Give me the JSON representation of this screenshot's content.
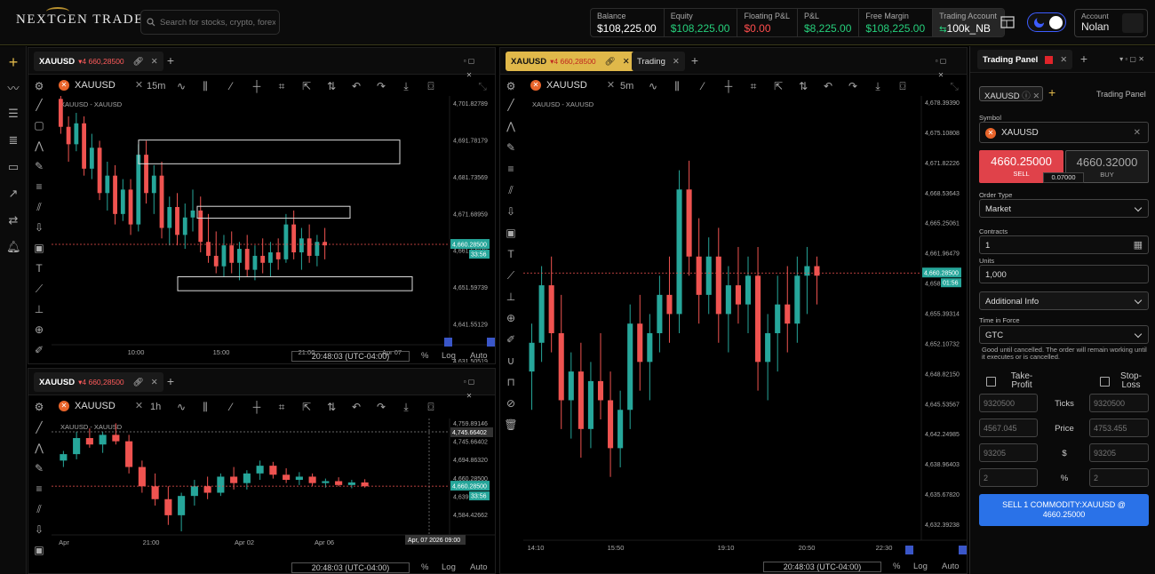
{
  "app": {
    "logo_text": "NEXTGEN TRADER"
  },
  "search": {
    "placeholder": "Search for stocks, crypto, forex..."
  },
  "stats": [
    {
      "label": "Balance",
      "value": "$108,225.00",
      "color": "#ffffff"
    },
    {
      "label": "Equity",
      "value": "$108,225.00",
      "color": "#26d07c"
    },
    {
      "label": "Floating P&L",
      "value": "$0.00",
      "color": "#ff4d4d"
    },
    {
      "label": "P&L",
      "value": "$8,225.00",
      "color": "#26d07c"
    },
    {
      "label": "Free Margin",
      "value": "$108,225.00",
      "color": "#26d07c"
    },
    {
      "label": "Trading Account",
      "value": "100k_NB",
      "color": "#ffffff"
    }
  ],
  "account": {
    "label": "Account",
    "name": "Nolan"
  },
  "colors": {
    "up": "#26a69a",
    "down": "#ef5350",
    "accent": "#e0b84a",
    "sell": "#e0424a",
    "buy_btn": "#1a1a1a",
    "order": "#2a72e8"
  },
  "panels": {
    "p1": {
      "tab_symbol": "XAUUSD",
      "tab_price": "▾4 660,28500",
      "symbol": "XAUUSD",
      "tf": "15m",
      "chart_title": "XAUUSD - XAUUSD",
      "yticks": [
        "4,701.82789",
        "4,691.78179",
        "4,681.73569",
        "4,671.68959",
        "4,661.64349",
        "4,651.59739",
        "4,641.55129",
        "4,631.50519"
      ],
      "xticks": [
        "10:00",
        "15:00",
        "21:00",
        "Apr 07"
      ],
      "price_label": "4,660.28500",
      "countdown": "33:56",
      "time": "20:48:03 (UTC-04:00)",
      "pct": "%",
      "log": "Log",
      "auto": "Auto"
    },
    "p2": {
      "tab_symbol": "XAUUSD",
      "tab_price": "▾4 660,28500",
      "tab2": "Trading",
      "symbol": "XAUUSD",
      "tf": "5m",
      "chart_title": "XAUUSD - XAUUSD",
      "yticks": [
        "4,678.39390",
        "4,675.10808",
        "4,671.82226",
        "4,668.53643",
        "4,665.25061",
        "4,661.96479",
        "4,658.67897",
        "4,655.39314",
        "4,652.10732",
        "4,648.82150",
        "4,645.53567",
        "4,642.24985",
        "4,638.96403",
        "4,635.67820",
        "4,632.39238"
      ],
      "xticks": [
        "14:10",
        "15:50",
        "19:10",
        "20:50",
        "22:30"
      ],
      "price_label": "4,660.28500",
      "countdown": "01:56",
      "time": "20:48:03 (UTC-04:00)",
      "pct": "%",
      "log": "Log",
      "auto": "Auto"
    },
    "p3": {
      "tab_symbol": "XAUUSD",
      "tab_price": "▾4 660,28500",
      "symbol": "XAUUSD",
      "tf": "1h",
      "chart_title": "XAUUSD - XAUUSD",
      "yticks": [
        "4,759.89146",
        "4,745.66402",
        "4,694.86320",
        "4,660.28500",
        "4,639.14...",
        "4,584.42662"
      ],
      "xticks": [
        "Apr",
        "21:00",
        "Apr 02",
        "Apr 06"
      ],
      "crosshair_price": "4,745.66402",
      "crosshair_time": "Apr, 07 2026 09:00",
      "price_label": "4,660.28500",
      "countdown": "33:56",
      "time": "20:48:03 (UTC-04:00)",
      "pct": "%",
      "log": "Log",
      "auto": "Auto"
    }
  },
  "trading_panel": {
    "tab": "Trading Panel",
    "header": "Trading Panel",
    "chip": "XAUUSD",
    "symbol_label": "Symbol",
    "symbol": "XAUUSD",
    "sell_price": "4660.25000",
    "sell_label": "SELL",
    "buy_price": "4660.32000",
    "buy_label": "BUY",
    "spread": "0.07000",
    "order_type_label": "Order Type",
    "order_type": "Market",
    "contracts_label": "Contracts",
    "contracts": "1",
    "units_label": "Units",
    "units": "1,000",
    "additional_info": "Additional Info",
    "tif_label": "Time in Force",
    "tif": "GTC",
    "tif_note": "Good until cancelled. The order will remain working until it executes or is cancelled.",
    "tp_label": "Take-Profit",
    "sl_label": "Stop-Loss",
    "rows": [
      {
        "label": "Ticks",
        "tp": "9320500",
        "sl": "9320500"
      },
      {
        "label": "Price",
        "tp": "4567.045",
        "sl": "4753.455"
      },
      {
        "label": "$",
        "tp": "93205",
        "sl": "93205"
      },
      {
        "label": "%",
        "tp": "2",
        "sl": "2"
      }
    ],
    "submit": "SELL 1 COMMODITY:XAUUSD @ 4660.25000"
  },
  "chart_data": [
    {
      "type": "candlestick",
      "title": "XAUUSD - XAUUSD",
      "timeframe": "15m",
      "x_ticks": [
        "10:00",
        "15:00",
        "21:00",
        "Apr 07"
      ],
      "ylim": [
        4631.5,
        4701.83
      ],
      "last_price": 4660.285,
      "candles": [
        [
          4702,
          4706,
          4692,
          4694
        ],
        [
          4694,
          4697,
          4684,
          4689
        ],
        [
          4689,
          4698,
          4687,
          4695
        ],
        [
          4695,
          4697,
          4680,
          4682
        ],
        [
          4682,
          4692,
          4679,
          4688
        ],
        [
          4688,
          4690,
          4673,
          4675
        ],
        [
          4675,
          4684,
          4670,
          4680
        ],
        [
          4680,
          4683,
          4666,
          4669
        ],
        [
          4669,
          4679,
          4667,
          4676
        ],
        [
          4676,
          4679,
          4663,
          4666
        ],
        [
          4666,
          4689,
          4664,
          4686
        ],
        [
          4686,
          4690,
          4672,
          4675
        ],
        [
          4675,
          4683,
          4669,
          4680
        ],
        [
          4680,
          4684,
          4662,
          4665
        ],
        [
          4665,
          4674,
          4660,
          4671
        ],
        [
          4671,
          4675,
          4660,
          4663
        ],
        [
          4663,
          4672,
          4659,
          4668
        ],
        [
          4668,
          4676,
          4664,
          4670
        ],
        [
          4670,
          4674,
          4658,
          4661
        ],
        [
          4661,
          4669,
          4655,
          4657
        ],
        [
          4657,
          4664,
          4652,
          4654
        ],
        [
          4654,
          4663,
          4651,
          4660
        ],
        [
          4660,
          4664,
          4652,
          4655
        ],
        [
          4655,
          4661,
          4650,
          4659
        ],
        [
          4659,
          4663,
          4651,
          4653
        ],
        [
          4653,
          4660,
          4650,
          4657
        ],
        [
          4657,
          4662,
          4652,
          4655
        ],
        [
          4655,
          4661,
          4651,
          4658
        ],
        [
          4658,
          4662,
          4653,
          4656
        ],
        [
          4656,
          4669,
          4655,
          4666
        ],
        [
          4666,
          4670,
          4656,
          4658
        ],
        [
          4658,
          4665,
          4653,
          4662
        ],
        [
          4662,
          4666,
          4655,
          4657
        ],
        [
          4657,
          4663,
          4654,
          4661
        ],
        [
          4661,
          4665,
          4656,
          4660
        ]
      ]
    },
    {
      "type": "candlestick",
      "title": "XAUUSD - XAUUSD",
      "timeframe": "5m",
      "x_ticks": [
        "14:10",
        "15:50",
        "19:10",
        "20:50",
        "22:30"
      ],
      "ylim": [
        4632.39,
        4678.39
      ],
      "last_price": 4660.285,
      "candles": [
        [
          4650,
          4655,
          4646,
          4653
        ],
        [
          4653,
          4661,
          4651,
          4659
        ],
        [
          4659,
          4662,
          4652,
          4654
        ],
        [
          4654,
          4658,
          4644,
          4647
        ],
        [
          4647,
          4652,
          4643,
          4650
        ],
        [
          4650,
          4653,
          4641,
          4644
        ],
        [
          4644,
          4651,
          4642,
          4649
        ],
        [
          4649,
          4654,
          4645,
          4647
        ],
        [
          4647,
          4650,
          4639,
          4642
        ],
        [
          4642,
          4648,
          4640,
          4646
        ],
        [
          4646,
          4657,
          4644,
          4655
        ],
        [
          4655,
          4658,
          4648,
          4651
        ],
        [
          4651,
          4656,
          4647,
          4654
        ],
        [
          4654,
          4660,
          4652,
          4658
        ],
        [
          4658,
          4662,
          4653,
          4656
        ],
        [
          4656,
          4671,
          4654,
          4669
        ],
        [
          4669,
          4672,
          4660,
          4662
        ],
        [
          4662,
          4666,
          4655,
          4658
        ],
        [
          4658,
          4664,
          4656,
          4662
        ],
        [
          4662,
          4665,
          4653,
          4656
        ],
        [
          4656,
          4661,
          4652,
          4659
        ],
        [
          4659,
          4663,
          4655,
          4657
        ],
        [
          4657,
          4662,
          4654,
          4660
        ],
        [
          4660,
          4663,
          4648,
          4651
        ],
        [
          4651,
          4656,
          4647,
          4654
        ],
        [
          4654,
          4660,
          4650,
          4657
        ],
        [
          4657,
          4661,
          4652,
          4655
        ],
        [
          4655,
          4662,
          4653,
          4660
        ],
        [
          4660,
          4663,
          4656,
          4661
        ],
        [
          4661,
          4662,
          4657,
          4660
        ]
      ]
    },
    {
      "type": "candlestick",
      "title": "XAUUSD - XAUUSD",
      "timeframe": "1h",
      "x_ticks": [
        "Apr",
        "21:00",
        "Apr 02",
        "Apr 06"
      ],
      "ylim": [
        4584.43,
        4759.89
      ],
      "last_price": 4660.285,
      "candles": [
        [
          4700,
          4715,
          4690,
          4710
        ],
        [
          4710,
          4745,
          4702,
          4735
        ],
        [
          4735,
          4750,
          4720,
          4725
        ],
        [
          4725,
          4745,
          4712,
          4740
        ],
        [
          4740,
          4758,
          4725,
          4730
        ],
        [
          4730,
          4740,
          4680,
          4690
        ],
        [
          4690,
          4700,
          4650,
          4660
        ],
        [
          4660,
          4680,
          4630,
          4640
        ],
        [
          4640,
          4660,
          4600,
          4615
        ],
        [
          4615,
          4650,
          4590,
          4645
        ],
        [
          4645,
          4670,
          4630,
          4660
        ],
        [
          4660,
          4675,
          4640,
          4650
        ],
        [
          4650,
          4680,
          4645,
          4675
        ],
        [
          4675,
          4690,
          4655,
          4665
        ],
        [
          4665,
          4685,
          4655,
          4680
        ],
        [
          4680,
          4700,
          4670,
          4692
        ],
        [
          4692,
          4698,
          4672,
          4678
        ],
        [
          4678,
          4688,
          4665,
          4670
        ],
        [
          4670,
          4682,
          4662,
          4675
        ],
        [
          4675,
          4680,
          4660,
          4665
        ],
        [
          4665,
          4672,
          4658,
          4668
        ],
        [
          4668,
          4674,
          4660,
          4662
        ],
        [
          4662,
          4670,
          4657,
          4666
        ],
        [
          4666,
          4671,
          4658,
          4660
        ]
      ]
    }
  ]
}
